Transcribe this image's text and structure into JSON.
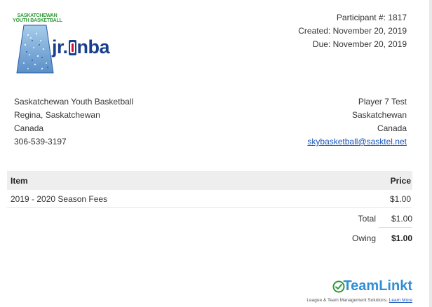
{
  "org_logo": {
    "line1": "SASKATCHEWAN",
    "line2": "YOUTH BASKETBALL",
    "brand_prefix": "jr.",
    "brand_suffix": "nba"
  },
  "invoice": {
    "participant": "Participant #: 1817",
    "created": "Created: November 20, 2019",
    "due": "Due: November 20, 2019"
  },
  "from": {
    "name": "Saskatchewan Youth Basketball",
    "city": "Regina, Saskatchewan",
    "country": "Canada",
    "phone": "306-539-3197"
  },
  "to": {
    "name": "Player 7 Test",
    "province": "Saskatchewan",
    "country": "Canada",
    "email": "skybasketball@sasktel.net"
  },
  "table": {
    "col_item": "Item",
    "col_price": "Price",
    "rows": [
      {
        "item": "2019 - 2020 Season Fees",
        "price": "$1.00"
      }
    ]
  },
  "totals": {
    "total_label": "Total",
    "total_value": "$1.00",
    "owing_label": "Owing",
    "owing_value": "$1.00"
  },
  "footer": {
    "brand_team": "Team",
    "brand_linkt": "Linkt",
    "tagline": "League & Team Management Solutions.",
    "learn_more": "Learn More"
  },
  "colors": {
    "link": "#1a56b8",
    "teamlinkt_blue": "#2f8fd6",
    "header_bg": "#eeeeee",
    "logo_green": "#2e9a36",
    "logo_blue": "#1b3f8f"
  }
}
